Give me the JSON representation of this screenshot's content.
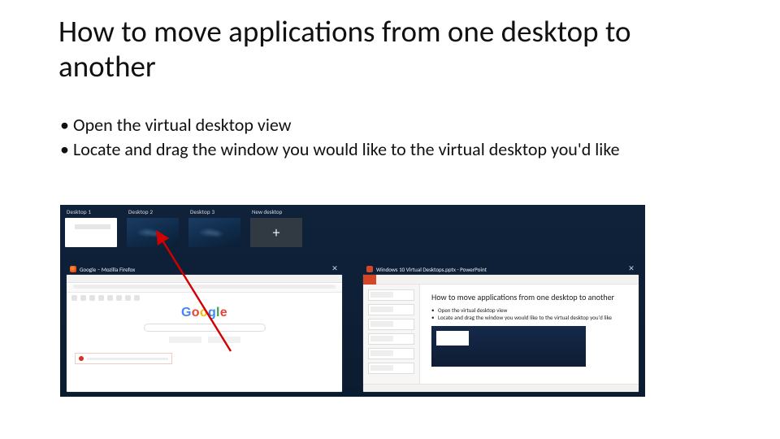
{
  "title": "How to move applications from one desktop to another",
  "bullets": [
    "Open the virtual desktop view",
    "Locate and drag the window you would like to the virtual desktop you'd like"
  ],
  "screenshot": {
    "desktops": [
      {
        "label": "Desktop 1",
        "active": true
      },
      {
        "label": "Desktop 2",
        "active": false
      },
      {
        "label": "Desktop 3",
        "active": false
      }
    ],
    "new_desktop_label": "New desktop",
    "plus_glyph": "+",
    "windows": {
      "firefox": {
        "title": "Google – Mozilla Firefox",
        "logo_letters": [
          "G",
          "o",
          "o",
          "g",
          "l",
          "e"
        ]
      },
      "powerpoint": {
        "title": "Windows 10 Virtual Desktops.pptx - PowerPoint",
        "slide_title": "How to move applications from one desktop to another",
        "slide_bullets": [
          "Open the virtual desktop view",
          "Locate and drag the window you would like to the virtual desktop you'd like"
        ]
      }
    }
  }
}
